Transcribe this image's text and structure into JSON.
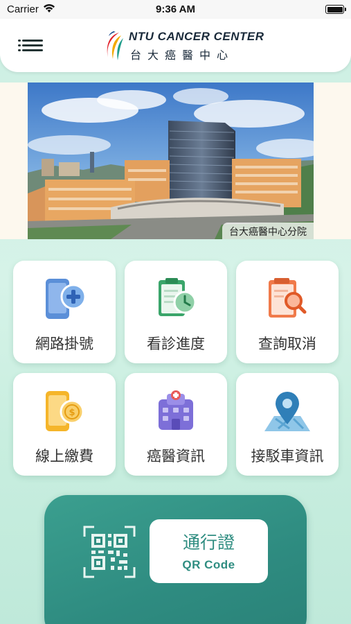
{
  "status_bar": {
    "carrier": "Carrier",
    "time": "9:36 AM"
  },
  "header": {
    "logo_en": "NTU CANCER CENTER",
    "logo_zh": "台大癌醫中心",
    "menu_icon": "hamburger-menu-icon"
  },
  "banner": {
    "caption": "台大癌醫中心分院"
  },
  "menu": {
    "items": [
      {
        "label": "網路掛號",
        "icon": "phone-plus-icon"
      },
      {
        "label": "看診進度",
        "icon": "clipboard-clock-icon"
      },
      {
        "label": "查詢取消",
        "icon": "document-search-icon"
      },
      {
        "label": "線上繳費",
        "icon": "phone-payment-icon"
      },
      {
        "label": "癌醫資訊",
        "icon": "hospital-building-icon"
      },
      {
        "label": "接駁車資訊",
        "icon": "map-pin-icon"
      }
    ]
  },
  "qr": {
    "title": "通行證",
    "subtitle": "QR Code",
    "icon": "qr-code-icon"
  },
  "colors": {
    "accent": "#2f8d81",
    "background": "#ccefe3",
    "tile": "#ffffff"
  }
}
